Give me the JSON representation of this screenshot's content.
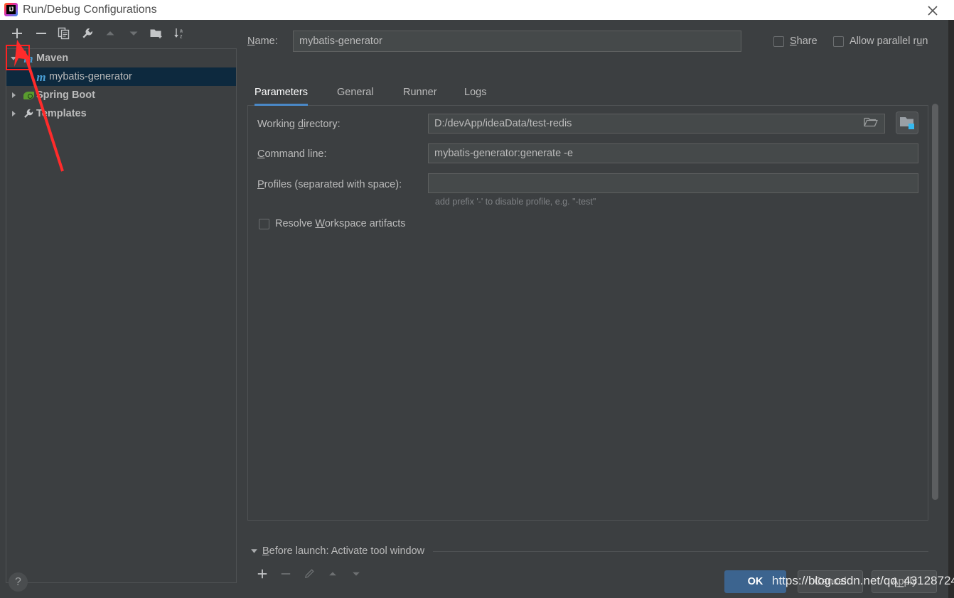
{
  "window": {
    "title": "Run/Debug Configurations",
    "logo_icon": "intellij-idea-logo",
    "logo_mark": "IJ",
    "close_icon": "close-icon"
  },
  "left_toolbar": {
    "buttons": [
      {
        "name": "add-configuration-button",
        "icon": "plus-icon",
        "enabled": true,
        "highlighted": true
      },
      {
        "name": "remove-configuration-button",
        "icon": "minus-icon",
        "enabled": true,
        "highlighted": false
      },
      {
        "name": "copy-configuration-button",
        "icon": "copy-icon",
        "enabled": true,
        "highlighted": false
      },
      {
        "name": "edit-templates-button",
        "icon": "wrench-icon",
        "enabled": true,
        "highlighted": false
      },
      {
        "name": "move-up-button",
        "icon": "arrow-up-icon",
        "enabled": false,
        "highlighted": false
      },
      {
        "name": "move-down-button",
        "icon": "arrow-down-icon",
        "enabled": false,
        "highlighted": false
      },
      {
        "name": "move-into-folder-button",
        "icon": "folder-add-icon",
        "enabled": true,
        "highlighted": false
      },
      {
        "name": "sort-configurations-button",
        "icon": "sort-az-icon",
        "enabled": true,
        "highlighted": false
      }
    ]
  },
  "tree": {
    "nodes": [
      {
        "label": "Maven",
        "icon": "maven-icon",
        "depth": 0,
        "expanded": true,
        "has_arrow": true,
        "selected": false,
        "bold": true
      },
      {
        "label": "mybatis-generator",
        "icon": "maven-icon",
        "depth": 1,
        "expanded": false,
        "has_arrow": false,
        "selected": true,
        "bold": false
      },
      {
        "label": "Spring Boot",
        "icon": "spring-boot-icon",
        "depth": 0,
        "expanded": false,
        "has_arrow": true,
        "selected": false,
        "bold": true
      },
      {
        "label": "Templates",
        "icon": "wrench-icon",
        "depth": 0,
        "expanded": false,
        "has_arrow": true,
        "selected": false,
        "bold": true
      }
    ]
  },
  "help_button": {
    "name": "help-button",
    "glyph": "?"
  },
  "name_row": {
    "label": "Name:",
    "label_mnemonic": "N",
    "value": "mybatis-generator",
    "share": {
      "label": "Share",
      "mnemonic": "S",
      "checked": false
    },
    "parallel": {
      "label": "Allow parallel run",
      "mnemonic": "u",
      "checked": false
    }
  },
  "tabs": [
    {
      "label": "Parameters",
      "active": true
    },
    {
      "label": "General",
      "active": false
    },
    {
      "label": "Runner",
      "active": false
    },
    {
      "label": "Logs",
      "active": false
    }
  ],
  "parameters": {
    "working_directory": {
      "label": "Working directory:",
      "label_pre": "Working ",
      "label_mnemonic": "d",
      "label_post": "irectory:",
      "value": "D:/devApp/ideaData/test-redis",
      "browse_icon": "folder-open-icon",
      "module_button_icon": "module-folder-icon"
    },
    "command_line": {
      "label": "Command line:",
      "label_mnemonic": "C",
      "label_post": "ommand line:",
      "value": "mybatis-generator:generate -e"
    },
    "profiles": {
      "label": "Profiles (separated with space):",
      "label_mnemonic": "P",
      "label_post": "rofiles (separated with space):",
      "value": "",
      "hint": "add prefix '-' to disable profile, e.g. \"-test\""
    },
    "resolve_workspace": {
      "label_pre": "Resolve ",
      "label_mnemonic": "W",
      "label_post": "orkspace artifacts",
      "label": "Resolve Workspace artifacts",
      "checked": false
    }
  },
  "before_launch": {
    "title": "Before launch: Activate tool window",
    "title_mnemonic": "B",
    "title_post": "efore launch: Activate tool window",
    "expanded": true,
    "toolbar": [
      {
        "name": "before-launch-add-button",
        "icon": "plus-icon",
        "enabled": true
      },
      {
        "name": "before-launch-remove-button",
        "icon": "minus-icon",
        "enabled": false
      },
      {
        "name": "before-launch-edit-button",
        "icon": "pencil-icon",
        "enabled": false
      },
      {
        "name": "before-launch-up-button",
        "icon": "arrow-up-icon",
        "enabled": false
      },
      {
        "name": "before-launch-down-button",
        "icon": "arrow-down-icon",
        "enabled": false
      }
    ]
  },
  "actions": {
    "ok": "OK",
    "cancel": "Cancel",
    "apply": "Apply"
  },
  "watermark": "https://blog.csdn.net/qq_43128724",
  "colors": {
    "dialog_background": "#3c3f41",
    "field_background": "#45494a",
    "selection_blue": "#0d293e",
    "accent_blue": "#4a88c7",
    "ok_button": "#3c648f",
    "annotation_red": "#ff2222",
    "maven_icon_blue": "#4a9fd6",
    "spring_green": "#5a9c2f"
  }
}
